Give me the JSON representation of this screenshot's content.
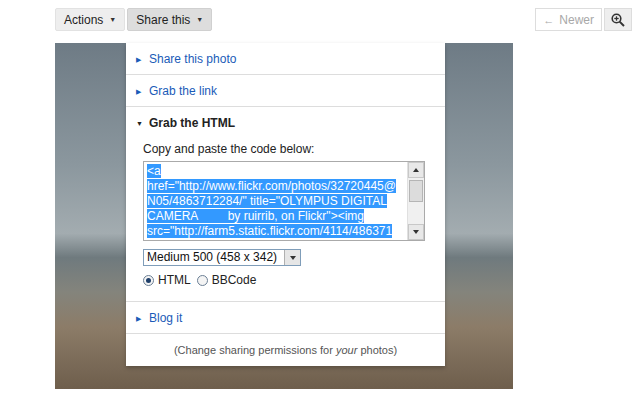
{
  "toolbar": {
    "menus": [
      {
        "label": "Actions",
        "icon": "▼",
        "selected": false
      },
      {
        "label": "Share this",
        "icon": "▼",
        "selected": true
      }
    ],
    "nav": [
      {
        "label": "Newer",
        "icon": "←",
        "disabled": true
      }
    ]
  },
  "share_menu": {
    "sections": [
      {
        "label": "Share this photo",
        "icon": "▶",
        "expanded": false
      },
      {
        "label": "Grab the link",
        "icon": "▶",
        "expanded": false
      },
      {
        "label": "Grab the HTML",
        "icon": "▼",
        "expanded": true
      },
      {
        "label": "Blog it",
        "icon": "▶",
        "expanded": false
      }
    ],
    "html_code": {
      "instruction": "Copy and paste the code below:",
      "lines": [
        "<a",
        "href=\"http://www.flickr.com/photos/32720445@",
        "N05/4863712284/\" title=\"OLYMPUS DIGITAL",
        "CAMERA         by ruirrib, on Flickr\"><img",
        "src=\"http://farm5.static.flickr.com/4114/486371"
      ],
      "selected": true,
      "size": "Medium 500 (458 x 342)",
      "formats": [
        {
          "label": "HTML",
          "selected": true
        },
        {
          "label": "BBCode",
          "selected": false
        }
      ]
    },
    "footer": {
      "before": "(Change sharing permissions for ",
      "emphasis": "your",
      "after": " photos)"
    }
  }
}
